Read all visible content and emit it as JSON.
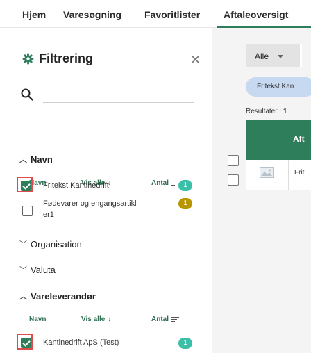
{
  "nav": {
    "tabs": [
      {
        "label": "Hjem"
      },
      {
        "label": "Varesøgning"
      },
      {
        "label": "Favoritlister"
      },
      {
        "label": "Aftaleoversigt"
      }
    ],
    "active_tab": "Aftaleoversigt"
  },
  "filter": {
    "title": "Filtrering",
    "icon": "gear-icon",
    "close_icon": "close-icon",
    "search": {
      "value": "",
      "placeholder": ""
    },
    "sections": {
      "navn": {
        "label": "Navn",
        "expanded": true,
        "columns": {
          "name": "Navn",
          "show_all": "Vis alle",
          "count": "Antal"
        },
        "items": [
          {
            "label": "Fritekst Kantinedrift",
            "count": "1",
            "checked": true,
            "badge_color": "#3cbfa8"
          },
          {
            "label": "Fødevarer og engangsartikl er1",
            "label_line1": "Fødevarer og engangsartikl",
            "label_line2": "er1",
            "count": "1",
            "checked": false,
            "badge_color": "#b89600"
          }
        ]
      },
      "organisation": {
        "label": "Organisation",
        "expanded": false
      },
      "valuta": {
        "label": "Valuta",
        "expanded": false
      },
      "vareleverandor": {
        "label": "Vareleverandør",
        "expanded": true,
        "columns": {
          "name": "Navn",
          "show_all": "Vis alle",
          "count": "Antal"
        },
        "items": [
          {
            "label": "Kantinedrift ApS (Test)",
            "count": "1",
            "checked": true,
            "badge_color": "#3cbfa8"
          }
        ]
      }
    }
  },
  "content": {
    "dropdown": {
      "selected": "Alle"
    },
    "chip": {
      "label": "Fritekst Kan"
    },
    "results": {
      "label": "Resultater :",
      "count": "1"
    },
    "table": {
      "header": "Aft",
      "rows": [
        {
          "name": "Frit"
        }
      ]
    }
  },
  "colors": {
    "accent": "#2e7d5b",
    "highlight": "#e04a4a",
    "chip": "#c6d9f1"
  }
}
